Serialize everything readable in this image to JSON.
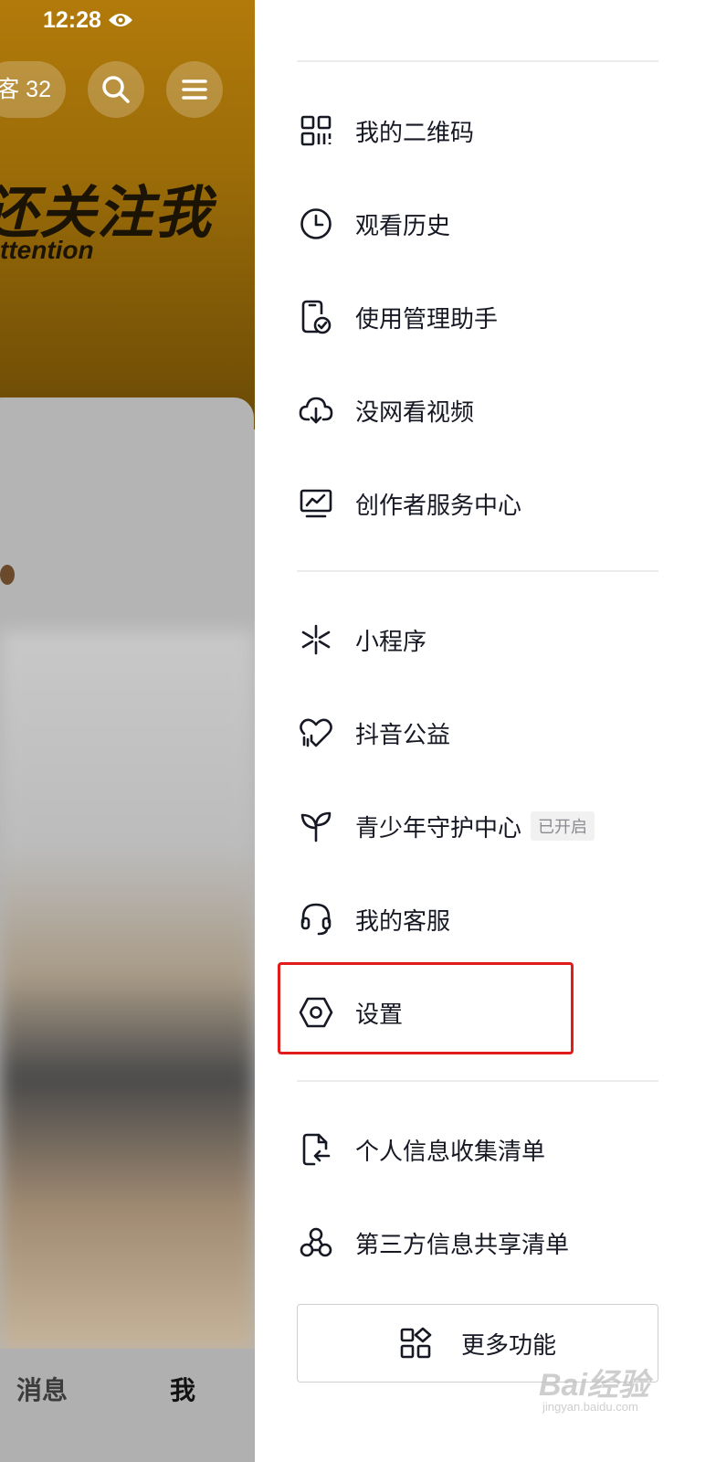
{
  "status_bar": {
    "time": "12:28",
    "icons": [
      "eye-icon"
    ]
  },
  "profile_header": {
    "visitor_badge": "客 32",
    "banner_title": "还关注我",
    "banner_subtitle": "ttention",
    "header_icons": [
      "search-icon",
      "menu-icon"
    ]
  },
  "bottom_nav": {
    "items": [
      {
        "label": "消息"
      },
      {
        "label": "我"
      }
    ]
  },
  "drawer": {
    "section1": [
      {
        "label": "我的二维码",
        "icon": "qr-code-icon"
      },
      {
        "label": "观看历史",
        "icon": "clock-icon"
      },
      {
        "label": "使用管理助手",
        "icon": "phone-check-icon"
      },
      {
        "label": "没网看视频",
        "icon": "cloud-download-icon"
      },
      {
        "label": "创作者服务中心",
        "icon": "chart-monitor-icon"
      }
    ],
    "section2": [
      {
        "label": "小程序",
        "icon": "mini-program-icon"
      },
      {
        "label": "抖音公益",
        "icon": "heart-charity-icon"
      },
      {
        "label": "青少年守护中心",
        "icon": "sprout-icon",
        "tag": "已开启"
      },
      {
        "label": "我的客服",
        "icon": "headset-icon"
      },
      {
        "label": "设置",
        "icon": "settings-hexagon-icon",
        "highlighted": true
      }
    ],
    "section3": [
      {
        "label": "个人信息收集清单",
        "icon": "document-icon"
      },
      {
        "label": "第三方信息共享清单",
        "icon": "share-nodes-icon"
      }
    ],
    "more_button": {
      "label": "更多功能",
      "icon": "apps-icon"
    }
  },
  "colors": {
    "highlight_border": "#e21b1b",
    "text_primary": "#161823",
    "banner_gold": "#b27a0a"
  },
  "watermark": {
    "text": "Bai经验",
    "sub": "jingyan.baidu.com"
  }
}
